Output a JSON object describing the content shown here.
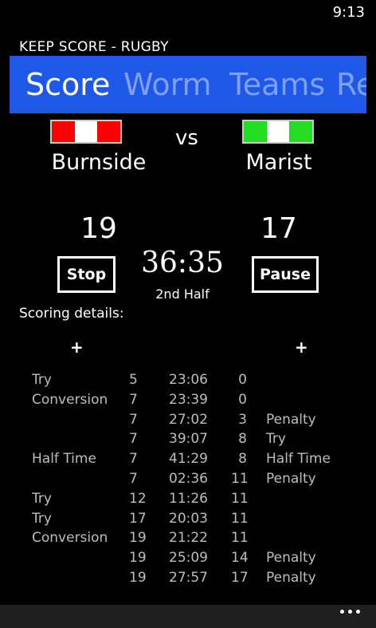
{
  "status": {
    "time": "9:13"
  },
  "app": {
    "title": "KEEP SCORE - RUGBY"
  },
  "tabs": [
    {
      "label": "Score",
      "active": true
    },
    {
      "label": "Worm",
      "active": false
    },
    {
      "label": "Teams",
      "active": false
    },
    {
      "label": "Re",
      "active": false
    }
  ],
  "match": {
    "vs_label": "vs",
    "home": {
      "name": "Burnside",
      "score": "19",
      "flag_colors": [
        "#ff0000",
        "#ffffff",
        "#ff0000"
      ]
    },
    "away": {
      "name": "Marist",
      "score": "17",
      "flag_colors": [
        "#22dd22",
        "#ffffff",
        "#22dd22"
      ]
    }
  },
  "controls": {
    "stop_label": "Stop",
    "pause_label": "Pause",
    "timer": "36:35",
    "period": "2nd Half"
  },
  "details": {
    "label": "Scoring details:",
    "add_home": "+",
    "add_away": "+",
    "rows": [
      {
        "home_event": "Try",
        "home_score": "5",
        "time": "23:06",
        "away_score": "0",
        "away_event": ""
      },
      {
        "home_event": "Conversion",
        "home_score": "7",
        "time": "23:39",
        "away_score": "0",
        "away_event": ""
      },
      {
        "home_event": "",
        "home_score": "7",
        "time": "27:02",
        "away_score": "3",
        "away_event": "Penalty"
      },
      {
        "home_event": "",
        "home_score": "7",
        "time": "39:07",
        "away_score": "8",
        "away_event": "Try"
      },
      {
        "home_event": "Half Time",
        "home_score": "7",
        "time": "41:29",
        "away_score": "8",
        "away_event": "Half Time"
      },
      {
        "home_event": "",
        "home_score": "7",
        "time": "02:36",
        "away_score": "11",
        "away_event": "Penalty"
      },
      {
        "home_event": "Try",
        "home_score": "12",
        "time": "11:26",
        "away_score": "11",
        "away_event": ""
      },
      {
        "home_event": "Try",
        "home_score": "17",
        "time": "20:03",
        "away_score": "11",
        "away_event": ""
      },
      {
        "home_event": "Conversion",
        "home_score": "19",
        "time": "21:22",
        "away_score": "11",
        "away_event": ""
      },
      {
        "home_event": "",
        "home_score": "19",
        "time": "25:09",
        "away_score": "14",
        "away_event": "Penalty"
      },
      {
        "home_event": "",
        "home_score": "19",
        "time": "27:57",
        "away_score": "17",
        "away_event": "Penalty"
      }
    ]
  },
  "appbar": {
    "more_icon": "ellipsis-icon"
  },
  "colors": {
    "pivot_bg": "#1f57e7",
    "pivot_inactive": "#7fa0f4",
    "detail_text": "#bdbdbd"
  }
}
